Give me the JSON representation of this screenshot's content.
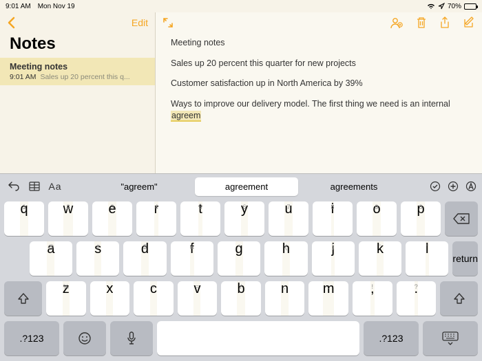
{
  "status": {
    "time": "9:01 AM",
    "date": "Mon Nov 19",
    "battery_pct": "70%"
  },
  "sidebar": {
    "edit_label": "Edit",
    "title": "Notes",
    "item": {
      "title": "Meeting notes",
      "time": "9:01 AM",
      "preview": "Sales up 20 percent this q..."
    }
  },
  "note": {
    "title": "Meeting notes",
    "p1": "Sales up 20 percent this quarter for new projects",
    "p2": "Customer satisfaction up in North America by 39%",
    "p3a": "Ways to improve our delivery model. The first thing we need is an internal ",
    "p3b_highlight": "agreem"
  },
  "suggestions": {
    "quoted": "\"agreem\"",
    "main": "agreement",
    "alt": "agreements"
  },
  "keyboard": {
    "row1_sub": [
      "1",
      "2",
      "3",
      "4",
      "5",
      "6",
      "7",
      "8",
      "9",
      "0"
    ],
    "row1": [
      "q",
      "w",
      "e",
      "r",
      "t",
      "y",
      "u",
      "i",
      "o",
      "p"
    ],
    "row2_sub": [
      "@",
      "#",
      "$",
      "&",
      "*",
      "(",
      ")",
      "'",
      "\""
    ],
    "row2": [
      "a",
      "s",
      "d",
      "f",
      "g",
      "h",
      "j",
      "k",
      "l"
    ],
    "return_label": "return",
    "row3_sub": [
      "%",
      "-",
      "+",
      "=",
      "/",
      ";",
      ":",
      "!",
      "?"
    ],
    "row3": [
      "z",
      "x",
      "c",
      "v",
      "b",
      "n",
      "m",
      ",",
      "."
    ],
    "row3_sub_last2": [
      "!",
      "?"
    ],
    "mode_label": ".?123",
    "aa_label": "Aa"
  }
}
